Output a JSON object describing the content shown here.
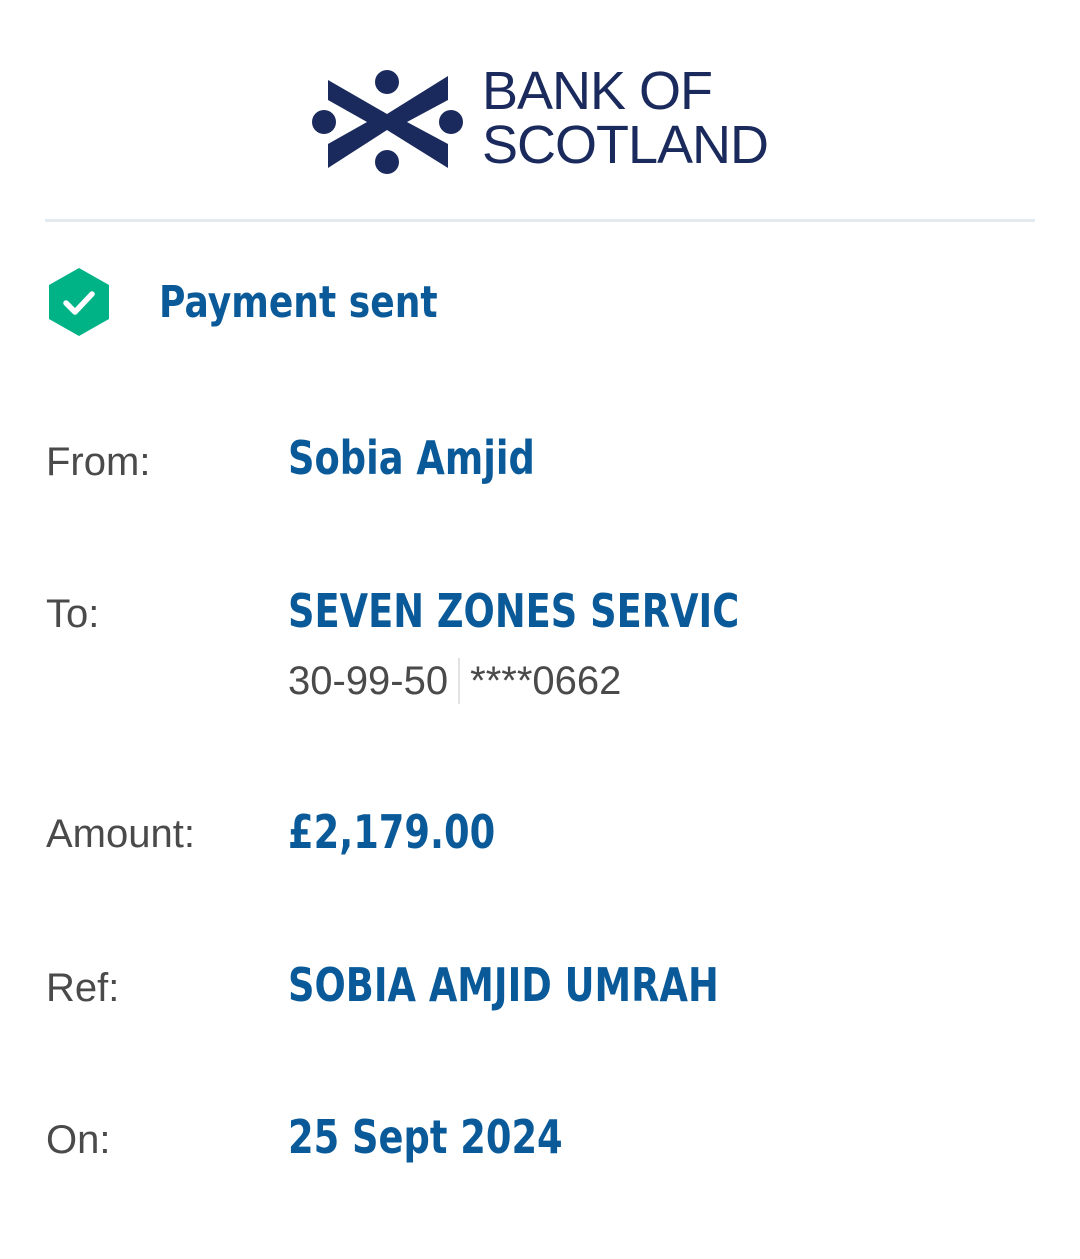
{
  "brand": {
    "name_line1": "BANK OF",
    "name_line2": "SCOTLAND",
    "logo": "bank-of-scotland-saltire-logo",
    "color": "#1a2a5c"
  },
  "status": {
    "icon": "check-hexagon-icon",
    "icon_color": "#00b386",
    "text": "Payment sent"
  },
  "details": {
    "from": {
      "label": "From:",
      "value": "Sobia Amjid"
    },
    "to": {
      "label": "To:",
      "value": "SEVEN ZONES SERVIC",
      "sort_code": "30-99-50",
      "account": "****0662"
    },
    "amount": {
      "label": "Amount:",
      "value": "£2,179.00"
    },
    "ref": {
      "label": "Ref:",
      "value": "SOBIA AMJID UMRAH"
    },
    "on": {
      "label": "On:",
      "value": "25 Sept 2024"
    }
  },
  "colors": {
    "accent": "#0a5a99",
    "label": "#4a4a4a",
    "divider": "#e3eaf0"
  }
}
